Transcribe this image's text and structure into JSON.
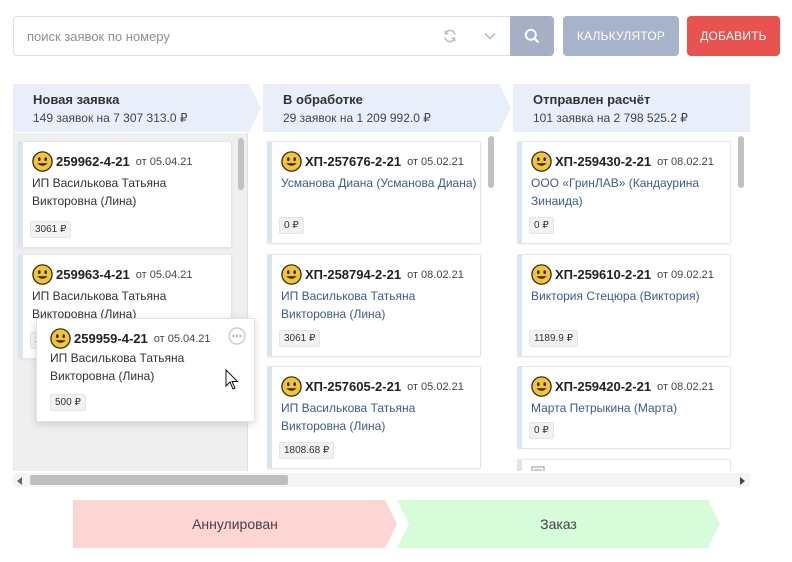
{
  "search": {
    "placeholder": "поиск заявок по номеру"
  },
  "toolbar": {
    "calc_label": "КАЛЬКУЛЯТОР",
    "add_label": "ДОБАВИТЬ"
  },
  "colors": {
    "accent_red": "#e8524f",
    "button_grey": "#a7b3cb",
    "header_blue": "#e8effb",
    "annul_pink": "#fdd5d3",
    "order_green": "#d6fcd9",
    "link_blue": "#3a5a9b"
  },
  "columns": [
    {
      "title": "Новая заявка",
      "summary": "149 заявок на 7 307 313.0 ₽",
      "cards": [
        {
          "number": "259962-4-21",
          "date": "от 05.04.21",
          "client": "ИП Василькова Татьяна Викторовна (Лина)",
          "price": "3061 ₽"
        },
        {
          "number": "259963-4-21",
          "date": "от 05.04.21",
          "client": "ИП Василькова Татьяна Викторовна (Лина)",
          "price": "3"
        }
      ]
    },
    {
      "title": "В обработке",
      "summary": "29 заявок на 1 209 992.0 ₽",
      "cards": [
        {
          "number": "ХП-257676-2-21",
          "date": "от 05.02.21",
          "client": "Усманова Диана (Усманова Диана)",
          "price": "0 ₽"
        },
        {
          "number": "ХП-258794-2-21",
          "date": "от 08.02.21",
          "client": "ИП Василькова Татьяна Викторовна (Лина)",
          "price": "3061 ₽"
        },
        {
          "number": "ХП-257605-2-21",
          "date": "от 05.02.21",
          "client": "ИП Василькова Татьяна Викторовна (Лина)",
          "price": "1808.68 ₽"
        }
      ]
    },
    {
      "title": "Отправлен расчёт",
      "summary": "101 заявка на 2 798 525.2 ₽",
      "cards": [
        {
          "number": "ХП-259430-2-21",
          "date": "от 08.02.21",
          "client": "ООО «ГринЛАВ» (Кандаурина Зинаида)",
          "price": "0 ₽"
        },
        {
          "number": "ХП-259610-2-21",
          "date": "от 09.02.21",
          "client": "Виктория Стецюра (Виктория)",
          "price": "1189.9 ₽"
        },
        {
          "number": "ХП-259420-2-21",
          "date": "от 08.02.21",
          "client": "Марта Петрыкина (Марта)",
          "price": "0 ₽"
        }
      ]
    }
  ],
  "dragging_card": {
    "number": "259959-4-21",
    "date": "от 05.04.21",
    "client": "ИП Василькова Татьяна Викторовна (Лина)",
    "price": "500 ₽"
  },
  "drop_zones": {
    "annul_label": "Аннулирован",
    "order_label": "Заказ"
  }
}
